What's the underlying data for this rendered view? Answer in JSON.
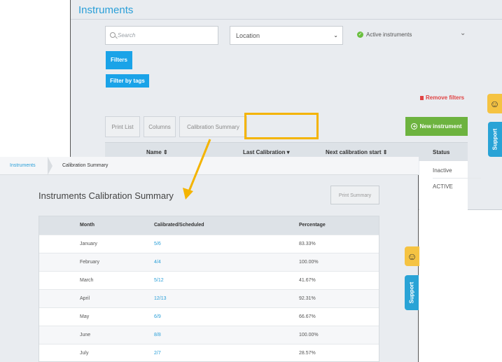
{
  "back_window": {
    "title": "Instruments",
    "search_placeholder": "Search",
    "location_value": "Location",
    "active_filter": "Active instruments",
    "filters_label": "Filters",
    "filter_by_tags_label": "Filter by tags",
    "remove_filters_label": "Remove filters",
    "tabs": {
      "print_list": "Print List",
      "columns": "Columns",
      "calibration_summary": "Calibration Summary"
    },
    "new_instrument_label": "New instrument",
    "columns_header": {
      "name": "Name ⇕",
      "last_calibration": "Last Calibration ▾",
      "next_calibration": "Next calibration start ⇕",
      "status": "Status"
    },
    "status_values": [
      "Inactive",
      "ACTIVE"
    ]
  },
  "support_label": "Support",
  "front_window": {
    "breadcrumb": {
      "home": "Instruments",
      "current": "Calibration Summary"
    },
    "title": "Instruments Calibration Summary",
    "print_summary_label": "Print Summary",
    "table": {
      "headers": {
        "month": "Month",
        "ratio": "Calibrated/Scheduled",
        "percentage": "Percentage"
      },
      "rows": [
        {
          "month": "January",
          "ratio": "5/6",
          "percentage": "83.33%"
        },
        {
          "month": "February",
          "ratio": "4/4",
          "percentage": "100.00%"
        },
        {
          "month": "March",
          "ratio": "5/12",
          "percentage": "41.67%"
        },
        {
          "month": "April",
          "ratio": "12/13",
          "percentage": "92.31%"
        },
        {
          "month": "May",
          "ratio": "6/9",
          "percentage": "66.67%"
        },
        {
          "month": "June",
          "ratio": "8/8",
          "percentage": "100.00%"
        },
        {
          "month": "July",
          "ratio": "2/7",
          "percentage": "28.57%"
        }
      ]
    }
  },
  "colors": {
    "accent": "#1aa3e8",
    "highlight": "#f4b400",
    "success": "#6db33f",
    "danger": "#e04444"
  }
}
